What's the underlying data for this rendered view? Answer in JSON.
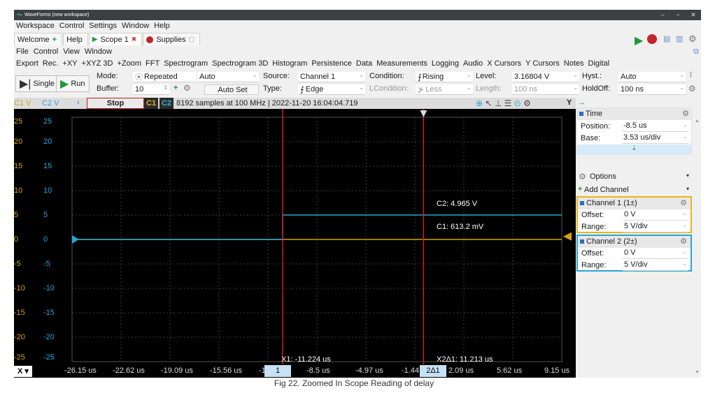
{
  "window": {
    "title": "WaveForms (new workspace)"
  },
  "menus": {
    "main": [
      "Workspace",
      "Control",
      "Settings",
      "Window",
      "Help"
    ],
    "scope": [
      "File",
      "Control",
      "View",
      "Window"
    ]
  },
  "tabs": [
    {
      "label": "Welcome",
      "icon": "plus-icon"
    },
    {
      "label": "Help"
    },
    {
      "label": "Scope 1",
      "icon": "play-icon"
    },
    {
      "label": "Supplies",
      "icon": "record-icon"
    }
  ],
  "toolbar": [
    "Export",
    "Rec.",
    "+XY",
    "+XYZ 3D",
    "+Zoom",
    "FFT",
    "Spectrogram",
    "Spectrogram 3D",
    "Histogram",
    "Persistence",
    "Data",
    "Measurements",
    "Logging",
    "Audio",
    "X Cursors",
    "Y Cursors",
    "Notes",
    "Digital"
  ],
  "controls": {
    "single_label": "Single",
    "run_label": "Run",
    "mode_label": "Mode:",
    "mode_value": "Repeated",
    "auto_value": "Auto",
    "buffer_label": "Buffer:",
    "buffer_value": "10",
    "autoset_label": "Auto Set",
    "source_label": "Source:",
    "source_value": "Channel 1",
    "type_label": "Type:",
    "type_value": "Edge",
    "condition_label": "Condition:",
    "condition_value": "Rising",
    "lcondition_label": "LCondition:",
    "lcondition_value": "Less",
    "level_label": "Level:",
    "level_value": "3.16804 V",
    "length_label": "Length:",
    "length_value": "100 ns",
    "hyst_label": "Hyst.:",
    "hyst_value": "Auto",
    "holdoff_label": "HoldOff:",
    "holdoff_value": "100 ns"
  },
  "status": {
    "c1_unit": "C1 V",
    "c2_unit": "C2 V",
    "state": "Stop",
    "c1_tag": "C1",
    "c2_tag": "C2",
    "info": "8192 samples at 100 MHz | 2022-11-20 16:04:04.719",
    "y_label": "Y"
  },
  "plot": {
    "y_ticks": [
      "25",
      "20",
      "15",
      "10",
      "5",
      "0",
      "-5",
      "-10",
      "-15",
      "-20",
      "-25"
    ],
    "x_ticks": [
      "-26.15 us",
      "-22.62 us",
      "-19.09 us",
      "-15.56 us",
      "-8.5 us",
      "-4.97 us",
      "2.09 us",
      "5.62 us",
      "9.15 us"
    ],
    "x_button": "X",
    "cursor1_tag": "1",
    "cursor2_tag": "2Δ1",
    "cursor_partial_label": "-1.44",
    "partial_tick_left": "-1",
    "x1_label": "X1: -11.224 us",
    "x2_label": "X2Δ1: 11.213 us",
    "c2_readout": "C2: 4.965 V",
    "c1_readout": "C1: 613.2 mV",
    "colors": {
      "c1": "#d4a30f",
      "c2": "#27a6d6",
      "cursor": "#d02020",
      "grid": "#3c3c3c"
    }
  },
  "chart_data": {
    "type": "line",
    "xlabel": "",
    "ylabel": "",
    "xlim": [
      -28,
      11
    ],
    "ylim": [
      -25,
      25
    ],
    "series": [
      {
        "name": "C1",
        "x": [
          -28,
          -11.224,
          11
        ],
        "y": [
          0,
          0,
          0
        ]
      },
      {
        "name": "C2",
        "x": [
          -28,
          -11.224,
          -11.224,
          11
        ],
        "y": [
          0,
          0,
          5,
          5
        ]
      }
    ],
    "cursors": [
      {
        "label": "X1",
        "x": -11.224
      },
      {
        "label": "X2",
        "x": -0.011
      }
    ]
  },
  "panel": {
    "time_title": "Time",
    "position_label": "Position:",
    "position_value": "-8.5 us",
    "base_label": "Base:",
    "base_value": "3.53 us/div",
    "options_label": "Options",
    "add_channel_label": "Add Channel",
    "ch1_title": "Channel 1 (1±)",
    "ch1_offset_label": "Offset:",
    "ch1_offset_value": "0 V",
    "ch1_range_label": "Range:",
    "ch1_range_value": "5 V/div",
    "ch2_title": "Channel 2 (2±)",
    "ch2_offset_label": "Offset:",
    "ch2_offset_value": "0 V",
    "ch2_range_label": "Range:",
    "ch2_range_value": "5 V/div"
  },
  "caption": "Fig 22. Zoomed In Scope Reading of delay"
}
